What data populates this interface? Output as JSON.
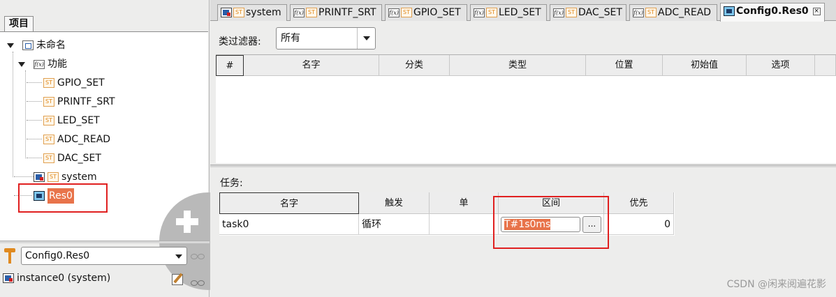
{
  "left_panel": {
    "tab_label": "项目",
    "tree": {
      "root": "未命名",
      "functions_folder": "功能",
      "functions": [
        "GPIO_SET",
        "PRINTF_SRT",
        "LED_SET",
        "ADC_READ",
        "DAC_SET"
      ],
      "system": "system",
      "resource": "Res0",
      "st_badge": "ST",
      "fx_badge": "f(x)"
    },
    "config_selector": {
      "value": "Config0.Res0"
    },
    "instance": "instance0 (system)"
  },
  "editor_tabs": [
    {
      "label": "system",
      "icon": "system-icon",
      "active": false
    },
    {
      "label": "PRINTF_SRT",
      "icon": "function-st-icon",
      "active": false
    },
    {
      "label": "GPIO_SET",
      "icon": "function-st-icon",
      "active": false
    },
    {
      "label": "LED_SET",
      "icon": "function-st-icon",
      "active": false
    },
    {
      "label": "DAC_SET",
      "icon": "function-st-icon",
      "active": false
    },
    {
      "label": "ADC_READ",
      "icon": "function-st-icon",
      "active": false
    },
    {
      "label": "Config0.Res0",
      "icon": "resource-icon",
      "active": true
    }
  ],
  "close_glyph": "×",
  "filter": {
    "label": "类过滤器:",
    "value": "所有"
  },
  "variables_table": {
    "columns": [
      "#",
      "名字",
      "分类",
      "类型",
      "位置",
      "初始值",
      "选项"
    ]
  },
  "tasks": {
    "label": "任务:",
    "columns": [
      "名字",
      "触发",
      "单",
      "区间",
      "优先"
    ],
    "rows": [
      {
        "name": "task0",
        "trigger": "循环",
        "single": "",
        "interval": "T#1s0ms",
        "priority": "0"
      }
    ],
    "browse_button": "..."
  },
  "watermark": "CSDN @闲来阅遍花影",
  "colors": {
    "selection": "#e8734a",
    "highlight_box": "#e02020",
    "add_button": "#b9b9b9"
  }
}
